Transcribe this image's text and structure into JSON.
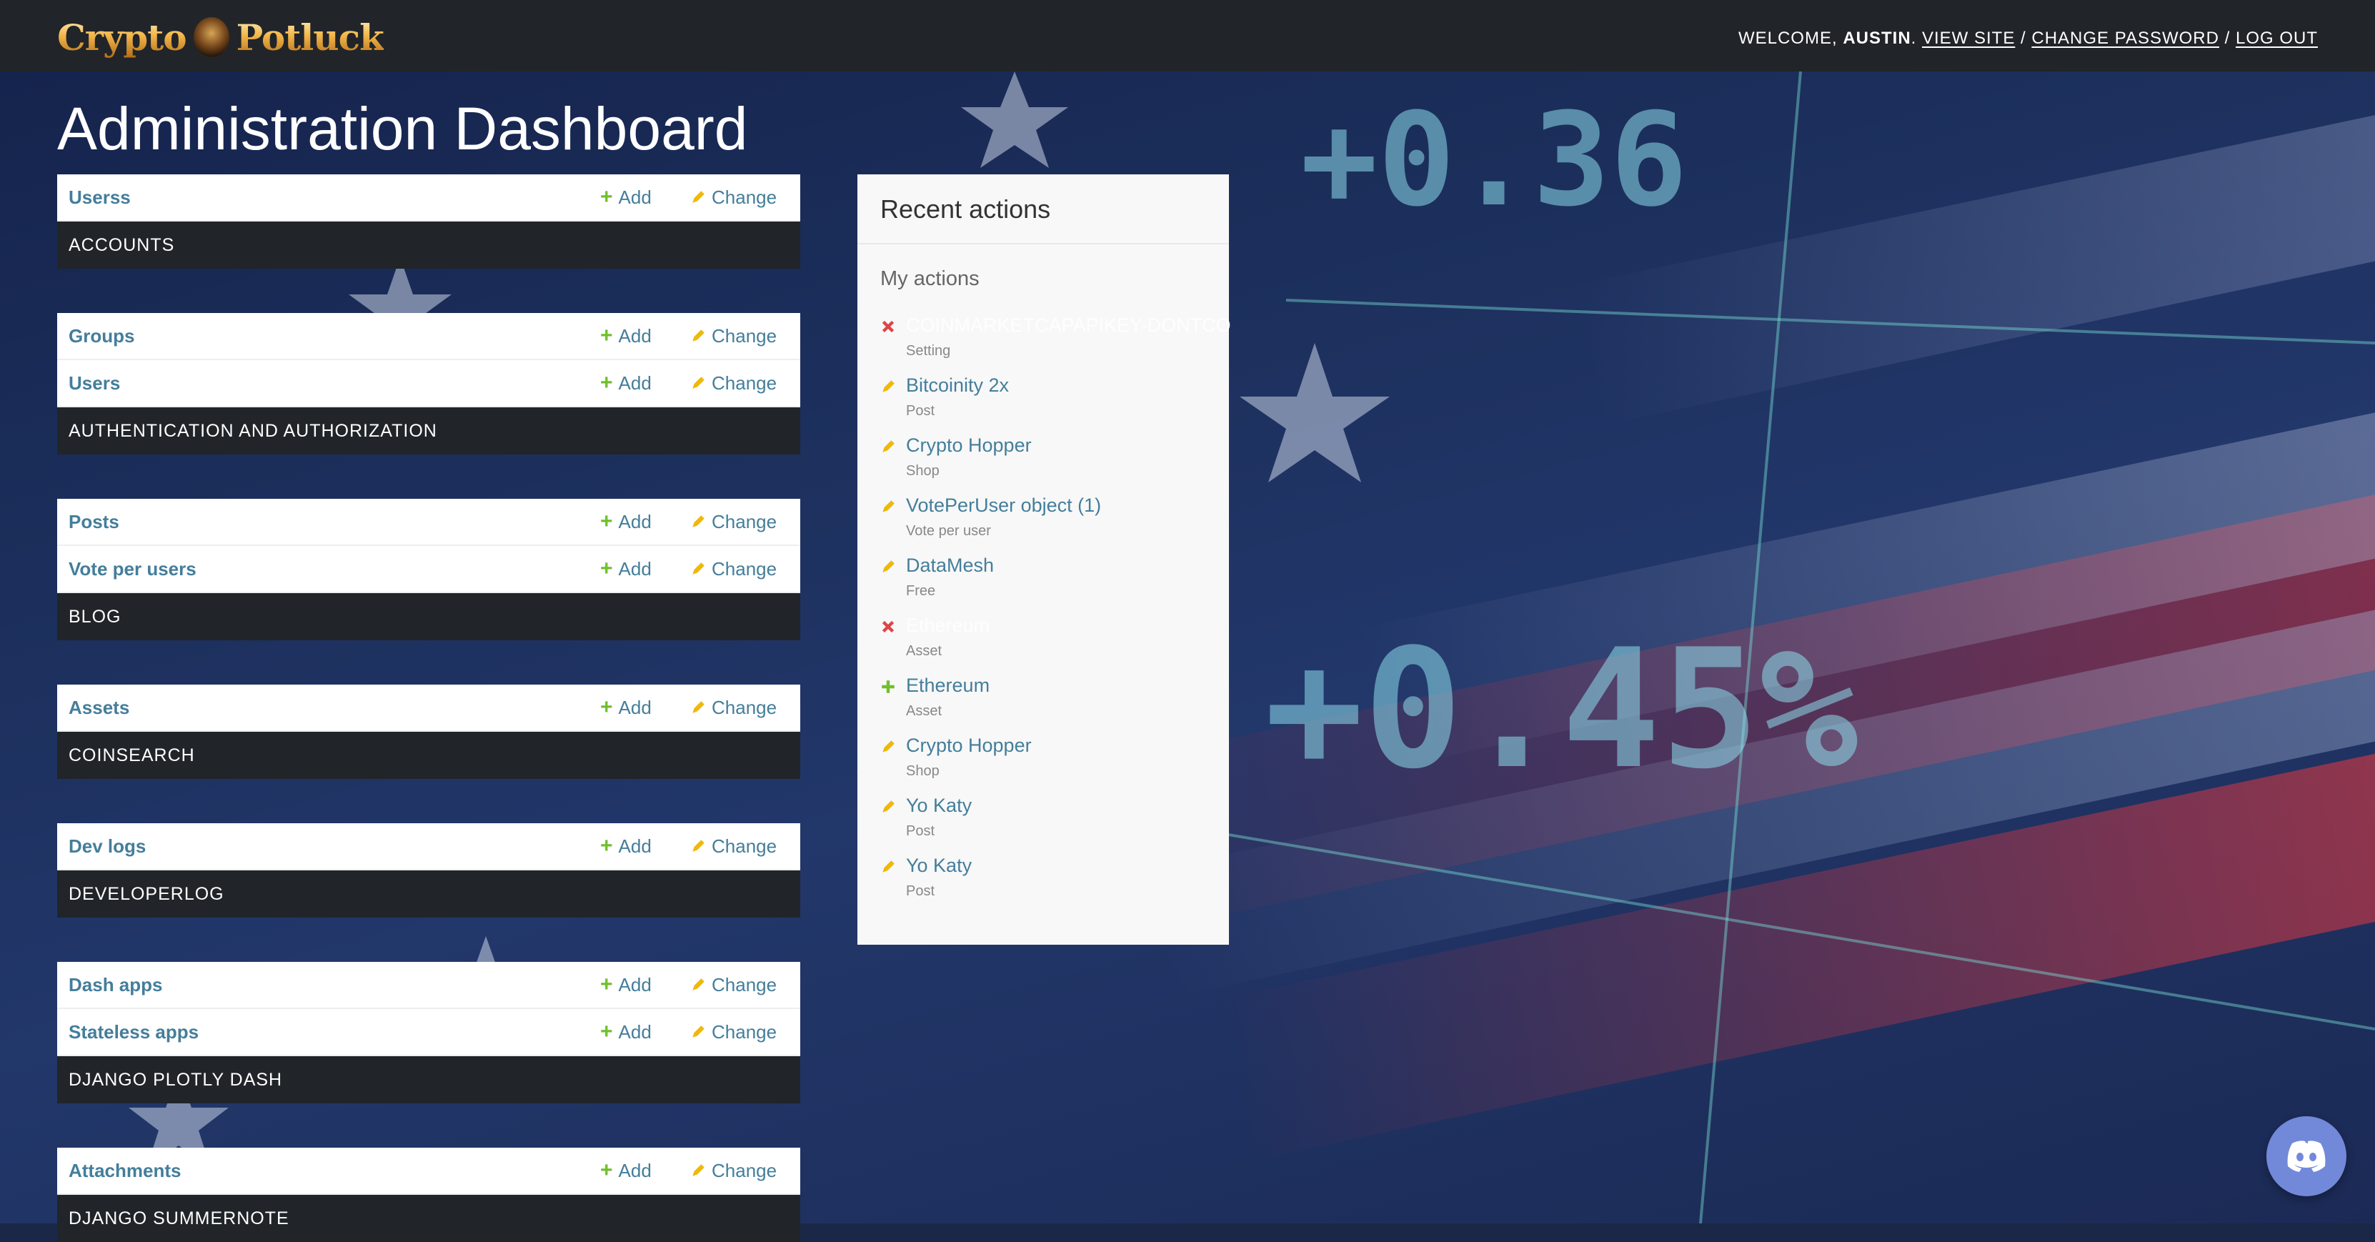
{
  "header": {
    "brand_left": "Crypto",
    "brand_right": "Potluck",
    "welcome": "Welcome,",
    "username": "Austin",
    "view_site": "View site",
    "change_password": "Change password",
    "log_out": "Log out",
    "separator": "/"
  },
  "page_title": "Administration Dashboard",
  "add_label": "Add",
  "change_label": "Change",
  "modules": [
    {
      "caption": "ACCOUNTS",
      "models": [
        "Userss"
      ]
    },
    {
      "caption": "AUTHENTICATION AND AUTHORIZATION",
      "models": [
        "Groups",
        "Users"
      ]
    },
    {
      "caption": "BLOG",
      "models": [
        "Posts",
        "Vote per users"
      ]
    },
    {
      "caption": "COINSEARCH",
      "models": [
        "Assets"
      ]
    },
    {
      "caption": "DEVELOPERLOG",
      "models": [
        "Dev logs"
      ]
    },
    {
      "caption": "DJANGO PLOTLY DASH",
      "models": [
        "Dash apps",
        "Stateless apps"
      ]
    },
    {
      "caption": "DJANGO SUMMERNOTE",
      "models": [
        "Attachments"
      ]
    }
  ],
  "recent": {
    "title": "Recent actions",
    "subtitle": "My actions",
    "items": [
      {
        "kind": "delete",
        "title": "COINMARKETCAPAPIKEY-DONTCO",
        "type": "Setting"
      },
      {
        "kind": "change",
        "title": "Bitcoinity 2x",
        "type": "Post"
      },
      {
        "kind": "change",
        "title": "Crypto Hopper",
        "type": "Shop"
      },
      {
        "kind": "change",
        "title": "VotePerUser object (1)",
        "type": "Vote per user"
      },
      {
        "kind": "change",
        "title": "DataMesh",
        "type": "Free"
      },
      {
        "kind": "delete",
        "title": "Ethereum",
        "type": "Asset"
      },
      {
        "kind": "add",
        "title": "Ethereum",
        "type": "Asset"
      },
      {
        "kind": "change",
        "title": "Crypto Hopper",
        "type": "Shop"
      },
      {
        "kind": "change",
        "title": "Yo Katy",
        "type": "Post"
      },
      {
        "kind": "change",
        "title": "Yo Katy",
        "type": "Post"
      }
    ]
  },
  "colors": {
    "header_bg": "#212529",
    "link": "#447e9b",
    "add_green": "#70bf2b",
    "change_yellow": "#efb80b",
    "delete_red": "#dd4646",
    "discord": "#7289da"
  },
  "icons": {
    "discord": "discord-icon"
  }
}
